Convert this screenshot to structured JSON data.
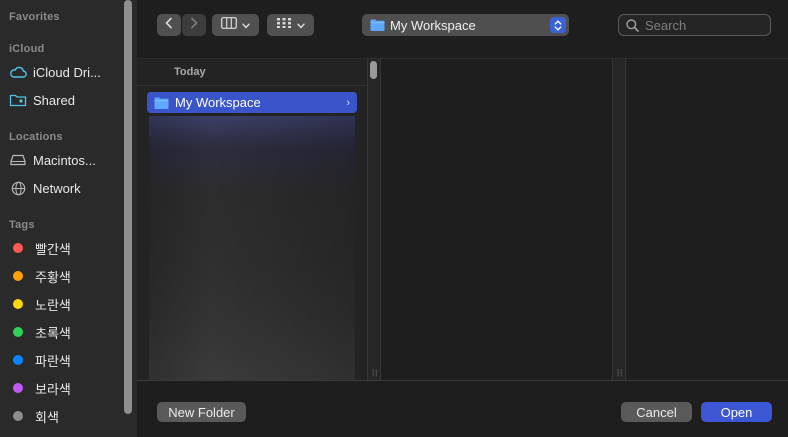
{
  "sidebar": {
    "favorites_header": "Favorites",
    "icloud_header": "iCloud",
    "icloud_items": [
      {
        "label": "iCloud Dri...",
        "icon": "cloud-icon"
      },
      {
        "label": "Shared",
        "icon": "shared-folder-icon"
      }
    ],
    "locations_header": "Locations",
    "location_items": [
      {
        "label": "Macintos...",
        "icon": "disk-icon"
      },
      {
        "label": "Network",
        "icon": "globe-icon"
      }
    ],
    "tags_header": "Tags",
    "tags": [
      {
        "label": "빨간색",
        "color": "#ff5a52"
      },
      {
        "label": "주황색",
        "color": "#ff9f0a"
      },
      {
        "label": "노란색",
        "color": "#ffd60a"
      },
      {
        "label": "초록색",
        "color": "#30d158"
      },
      {
        "label": "파란색",
        "color": "#0a84ff"
      },
      {
        "label": "보라색",
        "color": "#bf5af2"
      },
      {
        "label": "회색",
        "color": "#8e8e93"
      }
    ]
  },
  "toolbar": {
    "path_popup_label": "My Workspace",
    "search_placeholder": "Search"
  },
  "browser": {
    "group_label": "Today",
    "selected_item": "My Workspace"
  },
  "buttons": {
    "new_folder": "New Folder",
    "cancel": "Cancel",
    "open": "Open"
  },
  "colors": {
    "accent": "#3c56d6",
    "folder": "#5fa8ff"
  }
}
